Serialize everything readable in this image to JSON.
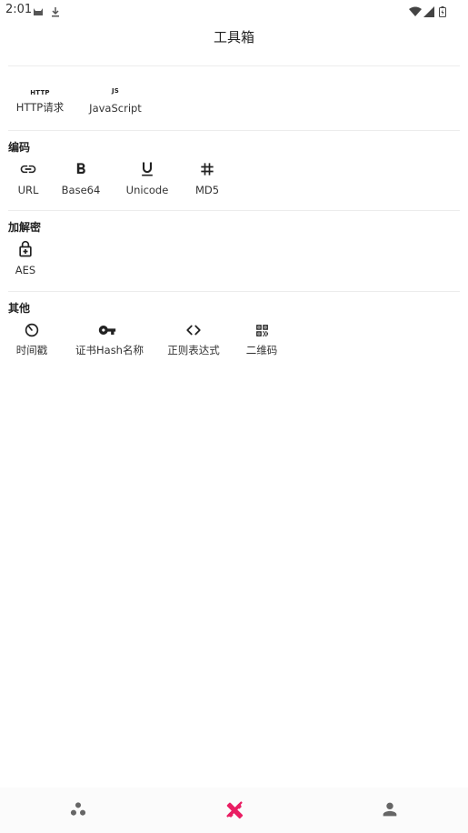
{
  "status_bar": {
    "time": "2:01"
  },
  "app_bar": {
    "title": "工具箱"
  },
  "sections": {
    "network": {
      "tools": [
        {
          "icon_text": "HTTP",
          "label": "HTTP请求"
        },
        {
          "icon_text": "JS",
          "label": "JavaScript"
        }
      ]
    },
    "encoding": {
      "title": "编码",
      "tools": [
        {
          "icon": "link-icon",
          "label": "URL"
        },
        {
          "icon": "bold-icon",
          "label": "Base64"
        },
        {
          "icon": "underline-icon",
          "label": "Unicode"
        },
        {
          "icon": "hash-icon",
          "label": "MD5"
        }
      ]
    },
    "crypto": {
      "title": "加解密",
      "tools": [
        {
          "icon": "lock-plus-icon",
          "label": "AES"
        }
      ]
    },
    "other": {
      "title": "其他",
      "tools": [
        {
          "icon": "timer-icon",
          "label": "时间戳"
        },
        {
          "icon": "key-icon",
          "label": "证书Hash名称"
        },
        {
          "icon": "code-brackets-icon",
          "label": "正则表达式"
        },
        {
          "icon": "qrcode-icon",
          "label": "二维码"
        }
      ]
    }
  },
  "bottom_nav": {
    "items": [
      {
        "icon": "dots-group-icon",
        "active": false
      },
      {
        "icon": "tools-icon",
        "active": true
      },
      {
        "icon": "person-icon",
        "active": false
      }
    ],
    "active_color": "#e91e63",
    "inactive_color": "#666666"
  }
}
